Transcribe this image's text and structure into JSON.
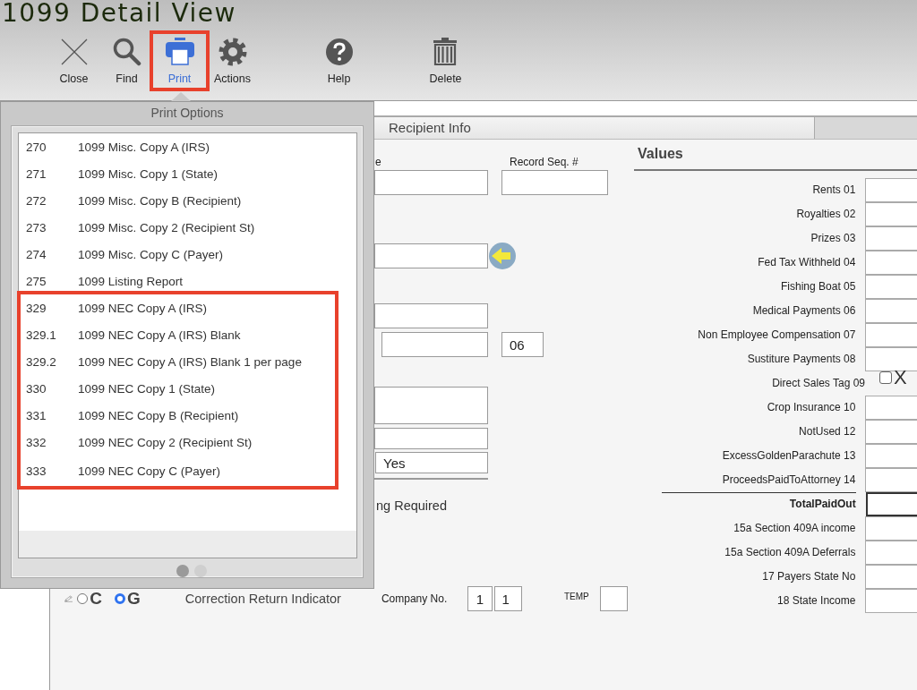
{
  "window": {
    "title": "1099 Detail View"
  },
  "toolbar": [
    {
      "label": "Close",
      "kind": "close",
      "selected": false,
      "highlighted": false
    },
    {
      "label": "Find",
      "kind": "find",
      "selected": false,
      "highlighted": false
    },
    {
      "label": "Print",
      "kind": "print",
      "selected": true,
      "highlighted": true
    },
    {
      "label": "Actions",
      "kind": "actions",
      "selected": false,
      "highlighted": false
    },
    {
      "label": "Help",
      "kind": "help",
      "selected": false,
      "highlighted": false
    },
    {
      "label": "Delete",
      "kind": "delete",
      "selected": false,
      "highlighted": false
    }
  ],
  "print_options": {
    "title": "Print Options",
    "items": [
      {
        "code": "270",
        "name": "1099 Misc. Copy A (IRS)",
        "highlighted": false
      },
      {
        "code": "271",
        "name": "1099 Misc. Copy 1 (State)",
        "highlighted": false
      },
      {
        "code": "272",
        "name": "1099 Misc. Copy B (Recipient)",
        "highlighted": false
      },
      {
        "code": "273",
        "name": "1099 Misc. Copy 2 (Recipient St)",
        "highlighted": false
      },
      {
        "code": "274",
        "name": "1099 Misc. Copy C (Payer)",
        "highlighted": false
      },
      {
        "code": "275",
        "name": "1099 Listing Report",
        "highlighted": false
      },
      {
        "code": "329",
        "name": "1099 NEC Copy A (IRS)",
        "highlighted": true
      },
      {
        "code": "329.1",
        "name": "1099 NEC Copy A (IRS) Blank",
        "highlighted": true
      },
      {
        "code": "329.2",
        "name": "1099 NEC Copy A (IRS) Blank 1 per page",
        "highlighted": true
      },
      {
        "code": "330",
        "name": "1099 NEC Copy 1 (State)",
        "highlighted": true
      },
      {
        "code": "331",
        "name": "1099 NEC Copy B (Recipient)",
        "highlighted": true
      },
      {
        "code": "332",
        "name": "1099 NEC Copy 2 (Recipient St)",
        "highlighted": true
      },
      {
        "code": "333",
        "name": "1099 NEC Copy C (Payer)",
        "highlighted": true
      }
    ],
    "page_dots": [
      {
        "selected": true
      },
      {
        "selected": false
      }
    ]
  },
  "recipient_info": {
    "title": "Recipient Info",
    "label_1": "e",
    "label_2": "Record Seq. #",
    "state_code": "06",
    "yes_value": "Yes",
    "note": "ng Required"
  },
  "bottom_row": {
    "radios": [
      {
        "label": "C",
        "selected": false
      },
      {
        "label": "G",
        "selected": true
      }
    ],
    "correction_label": "Correction Return Indicator",
    "company_label": "Company No.",
    "company_values": [
      "1",
      "1"
    ],
    "temp_label": "TEMP"
  },
  "values": {
    "title": "Values",
    "rows": [
      {
        "label": "Rents 01",
        "kind": "field"
      },
      {
        "label": "Royalties 02",
        "kind": "field"
      },
      {
        "label": "Prizes 03",
        "kind": "field"
      },
      {
        "label": "Fed Tax Withheld 04",
        "kind": "field"
      },
      {
        "label": "Fishing Boat 05",
        "kind": "field"
      },
      {
        "label": "Medical Payments 06",
        "kind": "field"
      },
      {
        "label": "Non Employee Compensation 07",
        "kind": "field"
      },
      {
        "label": "Sustiture Payments 08",
        "kind": "field"
      },
      {
        "label": "Direct Sales Tag 09",
        "kind": "checkbox",
        "checked": false,
        "mark": "X"
      },
      {
        "label": "Crop Insurance 10",
        "kind": "field"
      },
      {
        "label": "NotUsed 12",
        "kind": "field"
      },
      {
        "label": "ExcessGoldenParachute 13",
        "kind": "field"
      },
      {
        "label": "ProceedsPaidToAttorney 14",
        "kind": "field"
      },
      {
        "label": "TotalPaidOut",
        "kind": "total"
      },
      {
        "label": "15a Section 409A income",
        "kind": "field"
      },
      {
        "label": "15a Section 409A Deferrals",
        "kind": "field"
      },
      {
        "label": "17 Payers State No",
        "kind": "field"
      },
      {
        "label": "18 State Income",
        "kind": "field"
      }
    ]
  }
}
